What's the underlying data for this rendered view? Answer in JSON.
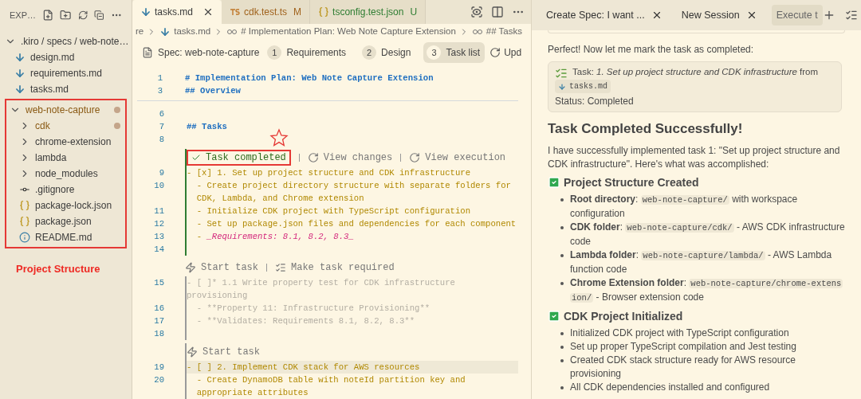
{
  "sidebar": {
    "title": "EXP…",
    "tree": [
      {
        "label": ".kiro / specs / web-note…",
        "kind": "folder",
        "expanded": true,
        "modified": false,
        "boxed": false,
        "children": [
          {
            "label": "design.md",
            "kind": "markdown",
            "modified": false
          },
          {
            "label": "requirements.md",
            "kind": "markdown",
            "modified": false
          },
          {
            "label": "tasks.md",
            "kind": "markdown",
            "modified": false
          }
        ]
      },
      {
        "label": "web-note-capture",
        "kind": "folder",
        "expanded": true,
        "modified": true,
        "boxed": true,
        "children": [
          {
            "label": "cdk",
            "kind": "folder",
            "expanded": false,
            "modified": true
          },
          {
            "label": "chrome-extension",
            "kind": "folder",
            "expanded": false,
            "modified": false
          },
          {
            "label": "lambda",
            "kind": "folder",
            "expanded": false,
            "modified": false
          },
          {
            "label": "node_modules",
            "kind": "folder",
            "expanded": false,
            "modified": false
          },
          {
            "label": ".gitignore",
            "kind": "git",
            "modified": false
          },
          {
            "label": "package-lock.json",
            "kind": "json",
            "modified": false
          },
          {
            "label": "package.json",
            "kind": "json",
            "modified": false
          },
          {
            "label": "README.md",
            "kind": "info",
            "modified": false
          }
        ]
      }
    ],
    "annotation": "Project Structure"
  },
  "editor": {
    "tabs": [
      {
        "label": "tasks.md",
        "kind": "markdown",
        "selected": true,
        "color": "#3a3a3a"
      },
      {
        "label": "cdk.test.ts",
        "kind": "typescript",
        "badge": "M",
        "selected": false,
        "color": "#a0621c"
      },
      {
        "label": "tsconfig.test.json",
        "kind": "json",
        "badge": "U",
        "selected": false,
        "color": "#2e7d32"
      }
    ],
    "breadcrumb": [
      {
        "text": "re",
        "kind": "folder"
      },
      {
        "text": "tasks.md",
        "kind": "markdown"
      },
      {
        "text": "# Implementation Plan: Web Note Capture Extension",
        "kind": "symbol"
      },
      {
        "text": "## Tasks",
        "kind": "symbol"
      }
    ],
    "spec_bar": {
      "title": "Spec: web-note-capture",
      "steps": [
        {
          "number": "1",
          "label": "Requirements",
          "selected": false
        },
        {
          "number": "2",
          "label": "Design",
          "selected": false
        },
        {
          "number": "3",
          "label": "Task list",
          "selected": true
        }
      ],
      "action": "Upd"
    },
    "sticky": [
      {
        "number": "1",
        "text": "# Implementation Plan: Web Note Capture Extension",
        "kind": "heading"
      },
      {
        "number": "3",
        "text": "## Overview",
        "kind": "heading"
      }
    ],
    "blocks": [
      {
        "kind": "plain",
        "lines": [
          {
            "number": "6",
            "kind": "blank",
            "current": false
          },
          {
            "number": "7",
            "text": "## Tasks",
            "kind": "heading",
            "current": false
          },
          {
            "number": "8",
            "kind": "blank",
            "current": false
          }
        ]
      },
      {
        "kind": "done",
        "lens": [
          {
            "label": "Task completed",
            "kind": "done",
            "boxed": true
          },
          {
            "label": "View changes",
            "kind": "refresh",
            "boxed": false
          },
          {
            "label": "View execution",
            "kind": "refresh",
            "boxed": false
          }
        ],
        "lines": [
          {
            "number": "9",
            "text": "- [x] 1. Set up project structure and CDK infrastructure",
            "kind": "task",
            "current": false
          },
          {
            "number": "10",
            "text": "  - Create project directory structure with separate folders for CDK, Lambda, and Chrome extension",
            "kind": "task",
            "current": false
          },
          {
            "number": "11",
            "text": "  - Initialize CDK project with TypeScript configuration",
            "kind": "task",
            "current": false
          },
          {
            "number": "12",
            "text": "  - Set up package.json files and dependencies for each component",
            "kind": "task",
            "current": false
          },
          {
            "number": "13",
            "kind": "mixed",
            "parts": [
              {
                "text": "  - ",
                "kind": "task"
              },
              {
                "text": "_Requirements: 8.1, 8.2, 8.3_",
                "kind": "emphasis"
              }
            ],
            "current": false
          },
          {
            "number": "14",
            "kind": "blank",
            "current": false
          }
        ]
      },
      {
        "kind": "optional",
        "lens": [
          {
            "label": "Start task",
            "kind": "bolt",
            "boxed": false
          },
          {
            "label": "Make task required",
            "kind": "list",
            "boxed": false
          }
        ],
        "lines": [
          {
            "number": "15",
            "text": "- [ ]* 1.1 Write property test for CDK infrastructure provisioning",
            "kind": "muted",
            "current": false
          },
          {
            "number": "16",
            "text": "  - **Property 11: Infrastructure Provisioning**",
            "kind": "muted",
            "current": false
          },
          {
            "number": "17",
            "text": "  - **Validates: Requirements 8.1, 8.2, 8.3**",
            "kind": "muted",
            "current": false
          },
          {
            "number": "18",
            "kind": "blank",
            "current": false
          }
        ]
      },
      {
        "kind": "pending",
        "lens": [
          {
            "label": "Start task",
            "kind": "bolt",
            "boxed": false
          }
        ],
        "lines": [
          {
            "number": "19",
            "text": "- [ ] 2. Implement CDK stack for AWS resources",
            "kind": "task",
            "current": true
          },
          {
            "number": "20",
            "text": "  - Create DynamoDB table with noteId partition key and appropriate attributes",
            "kind": "task",
            "current": false
          }
        ]
      }
    ]
  },
  "chat": {
    "tabs": [
      {
        "label": "Create Spec: I want ...",
        "selected": false
      },
      {
        "label": "New Session",
        "selected": false
      },
      {
        "label": "Execute t",
        "selected": true
      }
    ],
    "intro": "Perfect! Now let me mark the task as completed:",
    "tool_card": {
      "text": "Task: *1. Set up project structure and CDK infrastructure* from",
      "file": "tasks.md",
      "status": "Status: Completed"
    },
    "heading": "Task Completed Successfully!",
    "summary": "I have successfully implemented task 1: \"Set up project structure and CDK infrastructure\". Here's what was accomplished:",
    "sections": [
      {
        "title": "Project Structure Created",
        "items": [
          {
            "parts": [
              {
                "kind": "bold",
                "text": "Root directory"
              },
              {
                "kind": "plain",
                "text": ": "
              },
              {
                "kind": "code",
                "text": "web-note-capture/"
              },
              {
                "kind": "plain",
                "text": " with workspace configuration"
              }
            ]
          },
          {
            "parts": [
              {
                "kind": "bold",
                "text": "CDK folder"
              },
              {
                "kind": "plain",
                "text": ": "
              },
              {
                "kind": "code",
                "text": "web-note-capture/cdk/"
              },
              {
                "kind": "plain",
                "text": " - AWS CDK infrastructure code"
              }
            ]
          },
          {
            "parts": [
              {
                "kind": "bold",
                "text": "Lambda folder"
              },
              {
                "kind": "plain",
                "text": ": "
              },
              {
                "kind": "code",
                "text": "web-note-capture/lambda/"
              },
              {
                "kind": "plain",
                "text": " - AWS Lambda function code"
              }
            ]
          },
          {
            "parts": [
              {
                "kind": "bold",
                "text": "Chrome Extension folder"
              },
              {
                "kind": "plain",
                "text": ": "
              },
              {
                "kind": "code",
                "text": "web-note-capture/chrome-extension/"
              },
              {
                "kind": "plain",
                "text": " - Browser extension code"
              }
            ]
          }
        ]
      },
      {
        "title": "CDK Project Initialized",
        "items": [
          {
            "parts": [
              {
                "kind": "plain",
                "text": "Initialized CDK project with TypeScript configuration"
              }
            ]
          },
          {
            "parts": [
              {
                "kind": "plain",
                "text": "Set up proper TypeScript compilation and Jest testing"
              }
            ]
          },
          {
            "parts": [
              {
                "kind": "plain",
                "text": "Created CDK stack structure ready for AWS resource provisioning"
              }
            ]
          },
          {
            "parts": [
              {
                "kind": "plain",
                "text": "All CDK dependencies installed and configured"
              }
            ]
          }
        ]
      }
    ]
  }
}
